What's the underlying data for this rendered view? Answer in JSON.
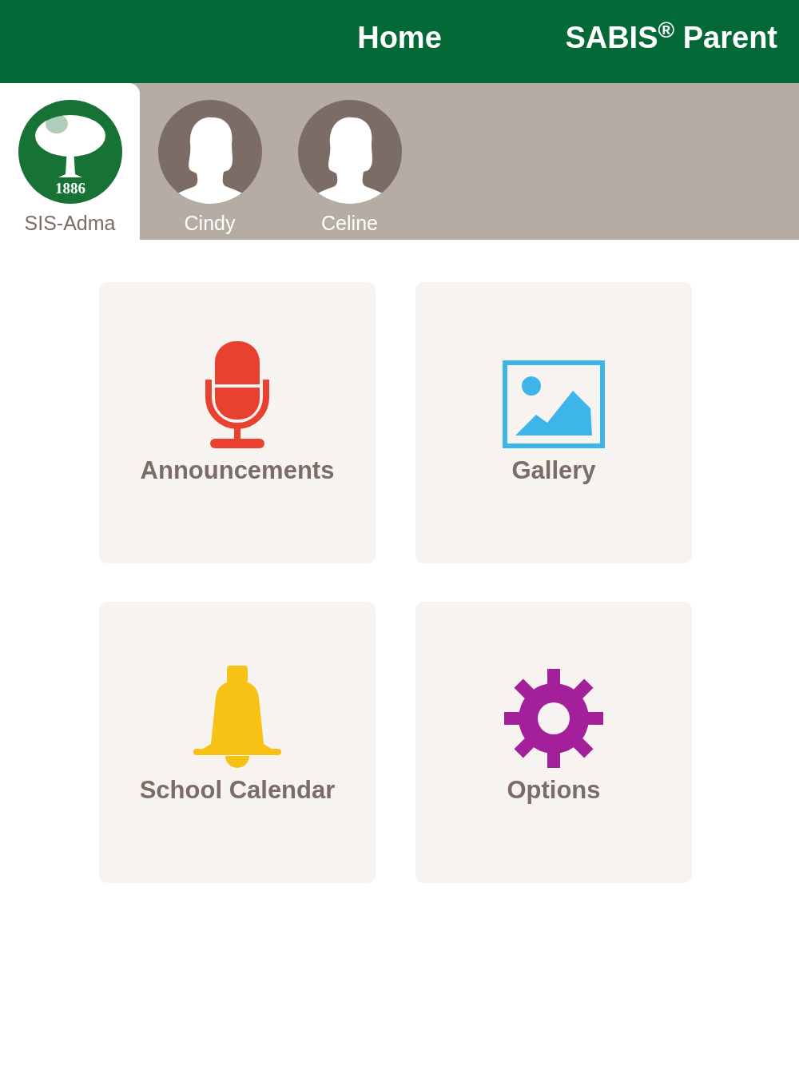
{
  "header": {
    "title": "Home",
    "brand": "SABIS$^{®}$ Parent"
  },
  "profiles": [
    {
      "name": "SIS-Adma",
      "kind": "school",
      "logo_text": "1886",
      "selected": true
    },
    {
      "name": "Cindy",
      "kind": "person",
      "selected": false
    },
    {
      "name": "Celine",
      "kind": "person",
      "selected": false
    }
  ],
  "tiles": [
    {
      "label": "Announcements",
      "kind": "microphone",
      "color": "#e8412f"
    },
    {
      "label": "Gallery",
      "kind": "image",
      "color": "#3db5e8"
    },
    {
      "label": "School Calendar",
      "kind": "bell",
      "color": "#f8c116"
    },
    {
      "label": "Options",
      "kind": "gear",
      "color": "#a4209a"
    }
  ]
}
